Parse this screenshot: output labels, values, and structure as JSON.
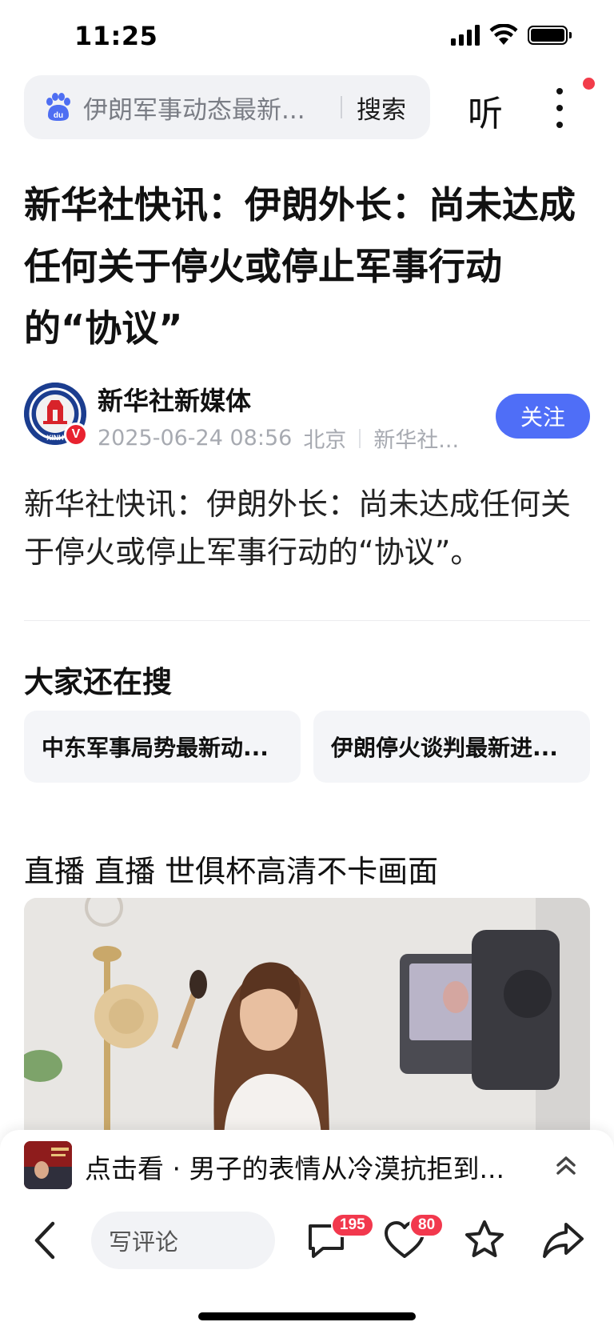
{
  "status_bar": {
    "time": "11:25"
  },
  "search": {
    "query": "伊朗军事动态最新...",
    "button_label": "搜索"
  },
  "header": {
    "listen_label": "听"
  },
  "article": {
    "title": "新华社快讯：伊朗外长：尚未达成任何关于停火或停止军事行动的“协议”",
    "author": {
      "name": "新华社新媒体",
      "verified_mark": "V",
      "avatar_text": "XINH"
    },
    "meta": {
      "datetime": "2025-06-24 08:56",
      "location": "北京",
      "source": "新华社..."
    },
    "follow_label": "关注",
    "body": "新华社快讯：伊朗外长：尚未达成任何关于停火或停止军事行动的“协议”。"
  },
  "related_search": {
    "title": "大家还在搜",
    "chips": [
      "中东军事局势最新动...",
      "伊朗停火谈判最新进..."
    ]
  },
  "ad": {
    "title": "直播 直播 世俱杯高清不卡画面"
  },
  "floating_video": {
    "text": "点击看 · 男子的表情从冷漠抗拒到..."
  },
  "toolbar": {
    "comment_placeholder": "写评论",
    "comment_count": "195",
    "like_count": "80"
  },
  "colors": {
    "accent": "#4f6ef7",
    "badge_red": "#f2384d"
  }
}
